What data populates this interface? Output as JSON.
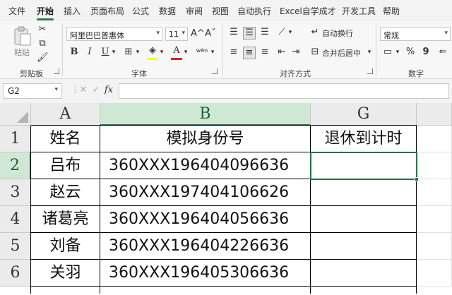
{
  "menubar": {
    "tabs": [
      "文件",
      "开始",
      "插入",
      "页面布局",
      "公式",
      "数据",
      "审阅",
      "视图",
      "自动执行",
      "Excel自学成才",
      "开发工具",
      "帮助"
    ],
    "active_tab": "开始"
  },
  "ribbon": {
    "clipboard": {
      "paste_label": "粘贴",
      "group_label": "剪贴板"
    },
    "font": {
      "font_name": "阿里巴巴普惠体",
      "font_size": "11",
      "grow_label": "A^",
      "shrink_label": "Aˇ",
      "bold_label": "B",
      "italic_label": "I",
      "underline_label": "U",
      "phonetic_label": "wén",
      "group_label": "字体",
      "fill_color": "#ffff00",
      "font_color": "#e02020"
    },
    "alignment": {
      "wrap_text_label": "自动换行",
      "merge_center_label": "合并后居中",
      "group_label": "对齐方式"
    },
    "number": {
      "format_value": "常规",
      "percent_label": "%",
      "comma_label": "9",
      "group_label": "数字"
    }
  },
  "formula_bar": {
    "name_box": "G2",
    "fx_label": "fx",
    "formula": ""
  },
  "sheet": {
    "columns": [
      {
        "name": "A",
        "selected": false
      },
      {
        "name": "B",
        "selected": true
      },
      {
        "name": "G",
        "selected": false
      }
    ],
    "rows": [
      {
        "num": "1",
        "cells": [
          "姓名",
          "模拟身份号",
          "退休到计时"
        ]
      },
      {
        "num": "2",
        "cells": [
          "吕布",
          "360XXX196404096636",
          ""
        ]
      },
      {
        "num": "3",
        "cells": [
          "赵云",
          "360XXX197404106626",
          ""
        ]
      },
      {
        "num": "4",
        "cells": [
          "诸葛亮",
          "360XXX196404056636",
          ""
        ]
      },
      {
        "num": "5",
        "cells": [
          "刘备",
          "360XXX196404226636",
          ""
        ]
      },
      {
        "num": "6",
        "cells": [
          "关羽",
          "360XXX196405306636",
          ""
        ]
      }
    ],
    "active_cell": "G2",
    "selection_color": "#217346"
  }
}
